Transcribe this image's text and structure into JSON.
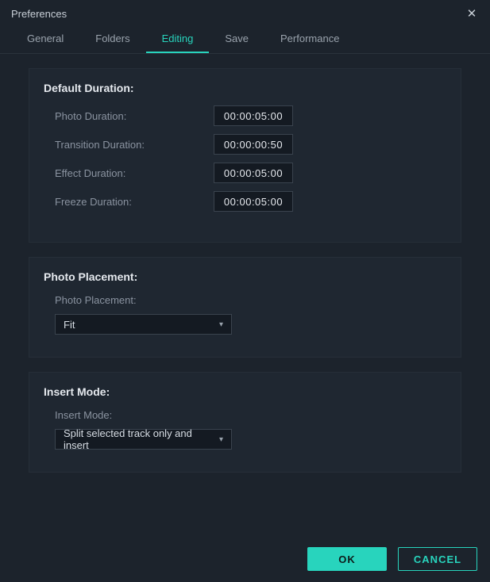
{
  "window": {
    "title": "Preferences"
  },
  "tabs": {
    "general": "General",
    "folders": "Folders",
    "editing": "Editing",
    "save": "Save",
    "performance": "Performance"
  },
  "default_duration": {
    "title": "Default Duration:",
    "photo_label": "Photo Duration:",
    "photo_value": "00:00:05:00",
    "transition_label": "Transition Duration:",
    "transition_value": "00:00:00:50",
    "effect_label": "Effect Duration:",
    "effect_value": "00:00:05:00",
    "freeze_label": "Freeze Duration:",
    "freeze_value": "00:00:05:00"
  },
  "photo_placement": {
    "title": "Photo Placement:",
    "sublabel": "Photo Placement:",
    "value": "Fit"
  },
  "insert_mode": {
    "title": "Insert Mode:",
    "sublabel": "Insert Mode:",
    "value": "Split selected track only and insert"
  },
  "footer": {
    "ok": "OK",
    "cancel": "CANCEL"
  }
}
